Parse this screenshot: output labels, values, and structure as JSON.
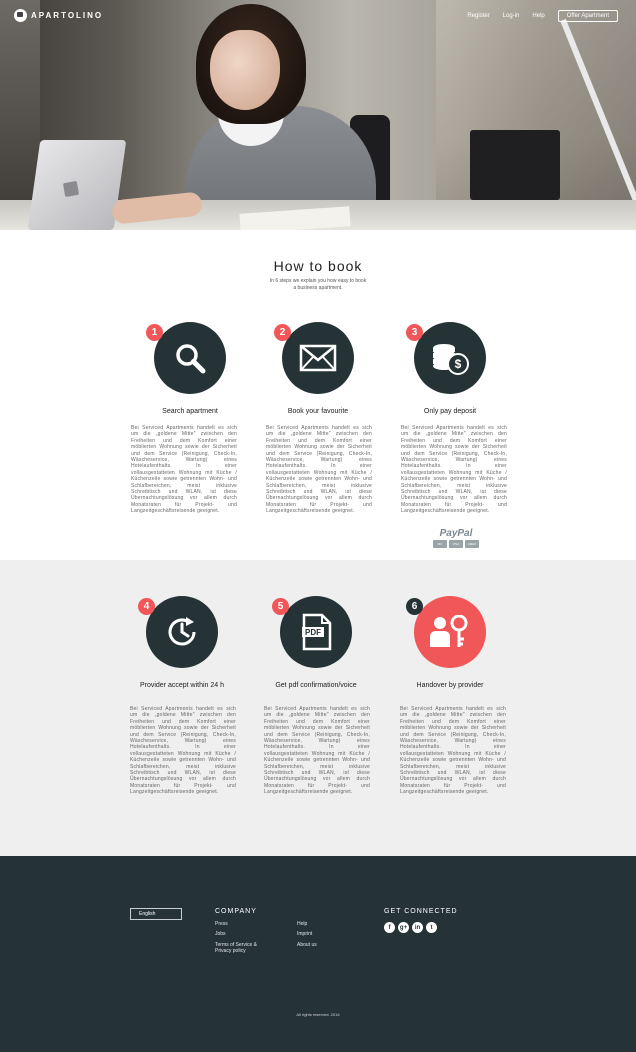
{
  "nav": {
    "brand": "APARTOLINO",
    "links": [
      "Register",
      "Log-in",
      "Help"
    ],
    "cta": "Offer Apartment"
  },
  "how": {
    "title": "How to book",
    "subtitle": "In 6 steps we explain you how easy to book a business apartment."
  },
  "steps": [
    {
      "num": "1",
      "title": "Search apartment",
      "icon": "search-icon",
      "desc": "Bei Serviced Apartments handelt es sich um die „goldene Mitte\" zwischen den Freiheiten und dem Komfort einer möblierten Wohnung sowie der Sicherheit und dem Service (Reinigung, Check-In, Wäscheservice, Wartung) eines Hotelaufenthalts. In einer vollausgestatteten Wohnung mit Küche / Küchenzeile sowie getrennten Wohn- und Schlafbereichen, meist inklusive Schreibtisch und WLAN, ist diese Übernachtungslösung vor allem durch Monatsraten für Projekt- und Langzeitgeschäftsreisende geeignet."
    },
    {
      "num": "2",
      "title": "Book your favourite",
      "icon": "envelope-icon",
      "desc": "Bei Serviced Apartments handelt es sich um die „goldene Mitte\" zwischen den Freiheiten und dem Komfort einer möblierten Wohnung sowie der Sicherheit und dem Service (Reinigung, Check-In, Wäscheservice, Wartung) eines Hotelaufenthalts. In einer vollausgestatteten Wohnung mit Küche / Küchenzeile sowie getrennten Wohn- und Schlafbereichen, meist inklusive Schreibtisch und WLAN, ist diese Übernachtungslösung vor allem durch Monatsraten für Projekt- und Langzeitgeschäftsreisende geeignet."
    },
    {
      "num": "3",
      "title": "Only pay deposit",
      "icon": "coins-icon",
      "desc": "Bei Serviced Apartments handelt es sich um die „goldene Mitte\" zwischen den Freiheiten und dem Komfort einer möblierten Wohnung sowie der Sicherheit und dem Service (Reinigung, Check-In, Wäscheservice, Wartung) eines Hotelaufenthalts. In einer vollausgestatteten Wohnung mit Küche / Küchenzeile sowie getrennten Wohn- und Schlafbereichen, meist inklusive Schreibtisch und WLAN, ist diese Übernachtungslösung vor allem durch Monatsraten für Projekt- und Langzeitgeschäftsreisende geeignet."
    },
    {
      "num": "4",
      "title": "Provider accept within 24 h",
      "icon": "clock-icon",
      "desc": "Bei Serviced Apartments handelt es sich um die „goldene Mitte\" zwischen den Freiheiten und dem Komfort einer möblierten Wohnung sowie der Sicherheit und dem Service (Reinigung, Check-In, Wäscheservice, Wartung) eines Hotelaufenthalts. In einer vollausgestatteten Wohnung mit Küche / Küchenzeile sowie getrennten Wohn- und Schlafbereichen, meist inklusive Schreibtisch und WLAN, ist diese Übernachtungslösung vor allem durch Monatsraten für Projekt- und Langzeitgeschäftsreisende geeignet."
    },
    {
      "num": "5",
      "title": "Get pdf confirmation/voice",
      "icon": "pdf-icon",
      "desc": "Bei Serviced Apartments handelt es sich um die „goldene Mitte\" zwischen den Freiheiten und dem Komfort einer möblierten Wohnung sowie der Sicherheit und dem Service (Reinigung, Check-In, Wäscheservice, Wartung) eines Hotelaufenthalts. In einer vollausgestatteten Wohnung mit Küche / Küchenzeile sowie getrennten Wohn- und Schlafbereichen, meist inklusive Schreibtisch und WLAN, ist diese Übernachtungslösung vor allem durch Monatsraten für Projekt- und Langzeitgeschäftsreisende geeignet."
    },
    {
      "num": "6",
      "title": "Handover by provider",
      "icon": "key-handover-icon",
      "desc": "Bei Serviced Apartments handelt es sich um die „goldene Mitte\" zwischen den Freiheiten und dem Komfort einer möblierten Wohnung sowie der Sicherheit und dem Service (Reinigung, Check-In, Wäscheservice, Wartung) eines Hotelaufenthalts. In einer vollausgestatteten Wohnung mit Küche / Küchenzeile sowie getrennten Wohn- und Schlafbereichen, meist inklusive Schreibtisch und WLAN, ist diese Übernachtungslösung vor allem durch Monatsraten für Projekt- und Langzeitgeschäftsreisende geeignet."
    }
  ],
  "payment": {
    "paypal": "PayPal",
    "cards": [
      "MC",
      "VISA",
      "AMEX"
    ]
  },
  "footer": {
    "language": "English",
    "company_heading": "COMPANY",
    "company_links": [
      "Press",
      "Jobs",
      "Terms of Service & Privacy policy"
    ],
    "more_links": [
      "Help",
      "Imprint",
      "About us"
    ],
    "social_heading": "GET CONNECTED",
    "social": [
      "f",
      "g+",
      "in",
      "t"
    ],
    "copyright": "All rights reserved. 2016"
  },
  "colors": {
    "dark": "#253337",
    "accent": "#f15658",
    "light_band": "#efefef"
  }
}
